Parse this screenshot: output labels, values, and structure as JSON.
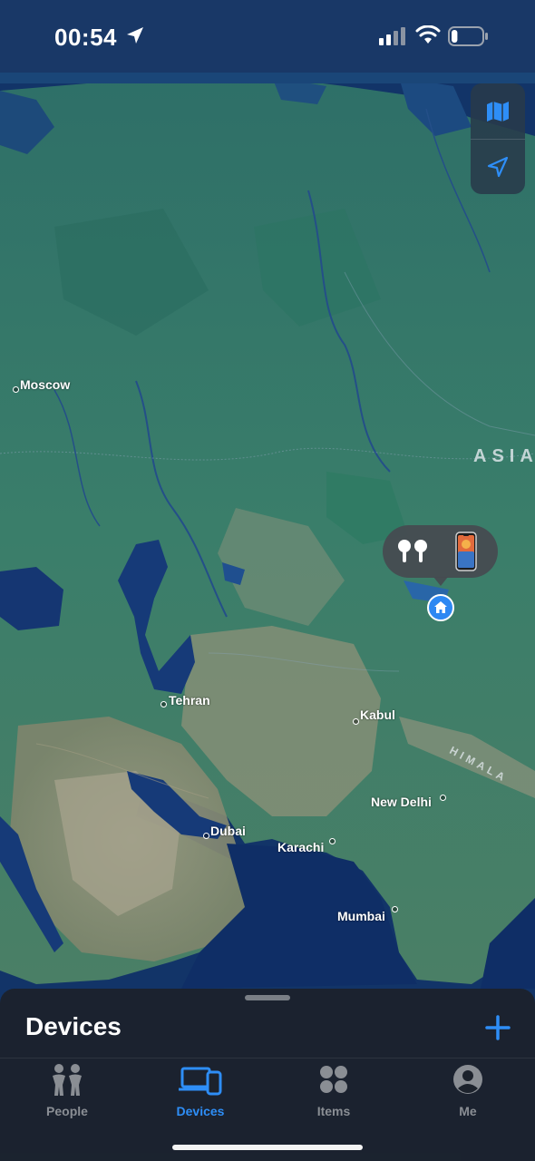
{
  "status_bar": {
    "time": "00:54",
    "battery_level": 0.2
  },
  "map": {
    "cities": [
      {
        "id": "moscow",
        "name": "Moscow"
      },
      {
        "id": "tehran",
        "name": "Tehran"
      },
      {
        "id": "kabul",
        "name": "Kabul"
      },
      {
        "id": "new-delhi",
        "name": "New Delhi"
      },
      {
        "id": "dubai",
        "name": "Dubai"
      },
      {
        "id": "karachi",
        "name": "Karachi"
      },
      {
        "id": "mumbai",
        "name": "Mumbai"
      }
    ],
    "regions": {
      "asia": "ASIA",
      "himalaya": "HIMALA"
    },
    "device_cluster": {
      "devices": [
        "airpods-icon",
        "iphone-icon"
      ],
      "pin_icon": "house-icon"
    },
    "controls": [
      "map-mode-icon",
      "location-arrow-icon"
    ]
  },
  "sheet": {
    "title": "Devices",
    "add_icon": "plus-icon"
  },
  "tabs": [
    {
      "label": "People",
      "icon": "people-icon",
      "active": false
    },
    {
      "label": "Devices",
      "icon": "devices-icon",
      "active": true
    },
    {
      "label": "Items",
      "icon": "items-icon",
      "active": false
    },
    {
      "label": "Me",
      "icon": "person-icon",
      "active": false
    }
  ],
  "colors": {
    "accent": "#2e8ef7",
    "water": "#14386e",
    "land": "#3b7d6a",
    "desert": "#8a8a6c"
  }
}
